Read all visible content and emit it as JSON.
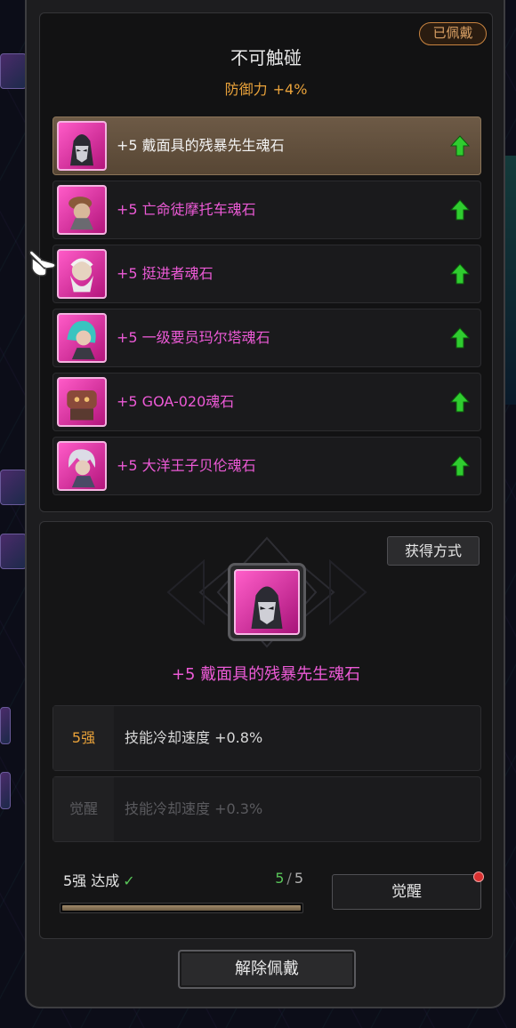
{
  "set": {
    "title": "不可触碰",
    "bonus_stat": "防御力",
    "bonus_value": "+4%",
    "status_badge": "已佩戴"
  },
  "stones": [
    {
      "label": "+5 戴面具的残暴先生魂石",
      "selected": true,
      "portrait_icon": "masked-villain-portrait-icon",
      "upgrade_icon": "green-up-arrow-icon"
    },
    {
      "label": "+5 亡命徒摩托车魂石",
      "selected": false,
      "portrait_icon": "outlaw-biker-portrait-icon",
      "upgrade_icon": "green-up-arrow-icon"
    },
    {
      "label": "+5 挺进者魂石",
      "selected": false,
      "portrait_icon": "bearded-old-man-portrait-icon",
      "upgrade_icon": "green-up-arrow-icon"
    },
    {
      "label": "+5 一级要员玛尔塔魂石",
      "selected": false,
      "portrait_icon": "cyan-haired-woman-portrait-icon",
      "upgrade_icon": "green-up-arrow-icon"
    },
    {
      "label": "+5 GOA-020魂石",
      "selected": false,
      "portrait_icon": "robot-tank-portrait-icon",
      "upgrade_icon": "green-up-arrow-icon"
    },
    {
      "label": "+5 大洋王子贝伦魂石",
      "selected": false,
      "portrait_icon": "silver-haired-prince-portrait-icon",
      "upgrade_icon": "green-up-arrow-icon"
    }
  ],
  "detail": {
    "obtain_label": "获得方式",
    "name": "+5 戴面具的残暴先生魂石",
    "effects": [
      {
        "tier": "5强",
        "text": "技能冷却速度 +0.8%",
        "active": true
      },
      {
        "tier": "觉醒",
        "text": "技能冷却速度 +0.3%",
        "active": false
      }
    ],
    "progress_label": "5强 达成",
    "progress_check": "✓",
    "progress_current": "5",
    "progress_sep": "/",
    "progress_max": "5",
    "progress_fraction": 1.0,
    "awaken_label": "觉醒",
    "awaken_has_notification": true
  },
  "footer": {
    "unequip_label": "解除佩戴"
  },
  "colors": {
    "accent_gold": "#e9a23a",
    "stone_name_pink": "#ec5ad6",
    "achieved_green": "#58c458",
    "badge_orange": "#c98440"
  }
}
